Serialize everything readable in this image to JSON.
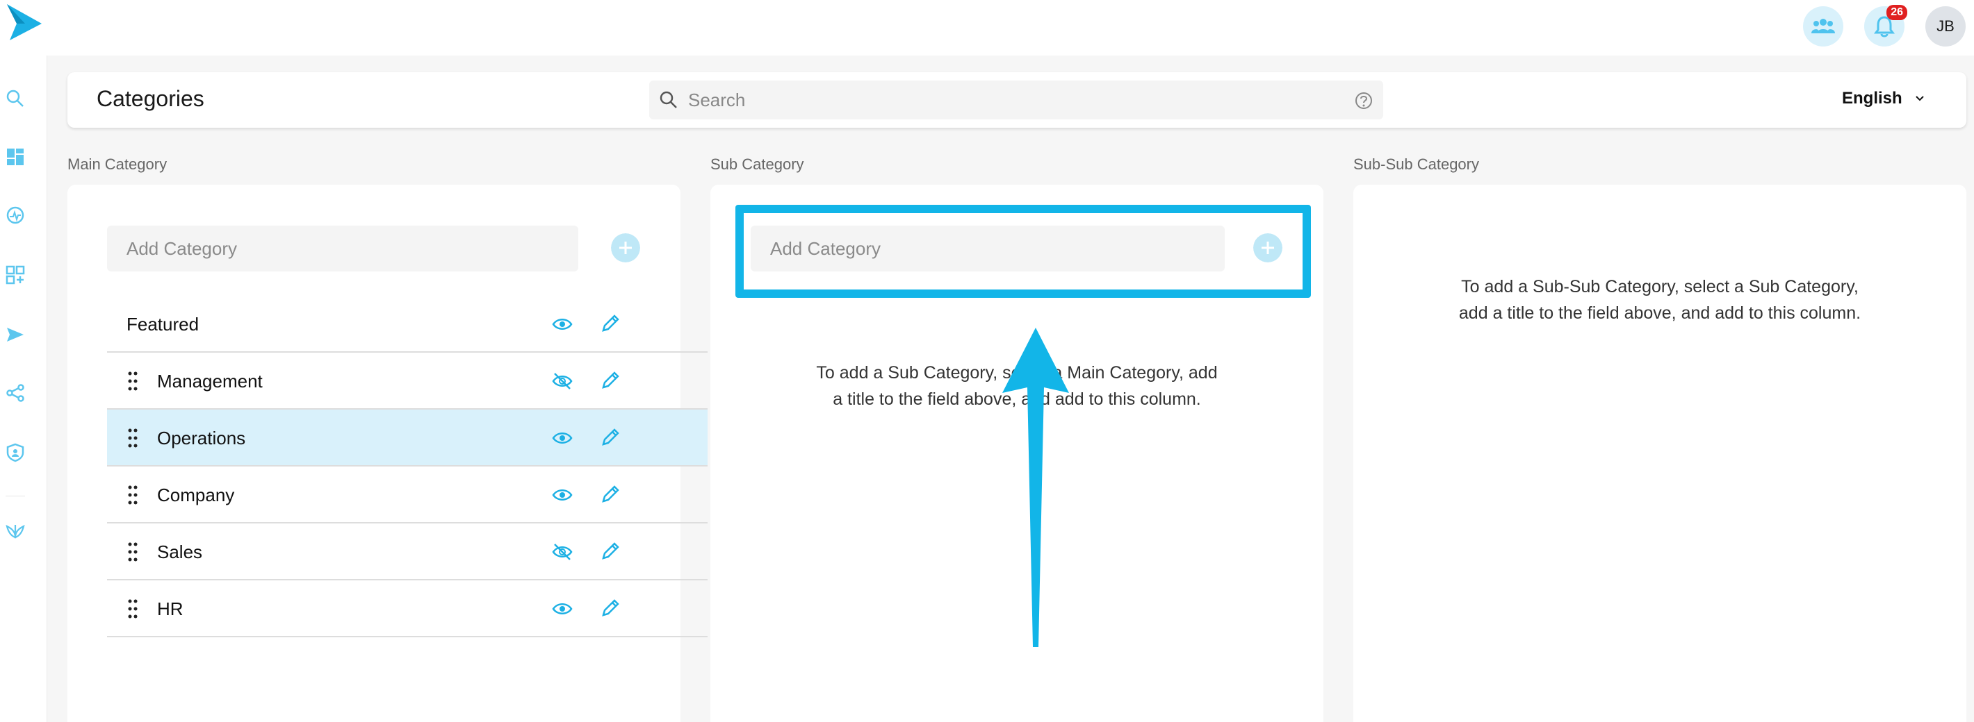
{
  "topbar": {
    "notification_count": "26",
    "avatar_initials": "JB"
  },
  "header": {
    "title": "Categories",
    "search_placeholder": "Search",
    "language": "English"
  },
  "columns": {
    "main": {
      "label": "Main Category",
      "add_placeholder": "Add Category",
      "items": [
        {
          "label": "Featured",
          "visible": true,
          "draggable": false
        },
        {
          "label": "Management",
          "visible": false,
          "draggable": true
        },
        {
          "label": "Operations",
          "visible": true,
          "draggable": true,
          "selected": true
        },
        {
          "label": "Company",
          "visible": true,
          "draggable": true
        },
        {
          "label": "Sales",
          "visible": false,
          "draggable": true
        },
        {
          "label": "HR",
          "visible": true,
          "draggable": true
        }
      ]
    },
    "sub": {
      "label": "Sub Category",
      "add_placeholder": "Add Category",
      "hint": "To add a Sub Category, select a Main Category, add a title to the field above, and add to this column."
    },
    "subsub": {
      "label": "Sub-Sub Category",
      "hint": "To add a Sub-Sub Category, select a Sub Category, add a title to the field above, and add to this column."
    }
  },
  "colors": {
    "accent": "#12b5e8",
    "accent_light": "#d9f1fb",
    "badge": "#e02020"
  }
}
